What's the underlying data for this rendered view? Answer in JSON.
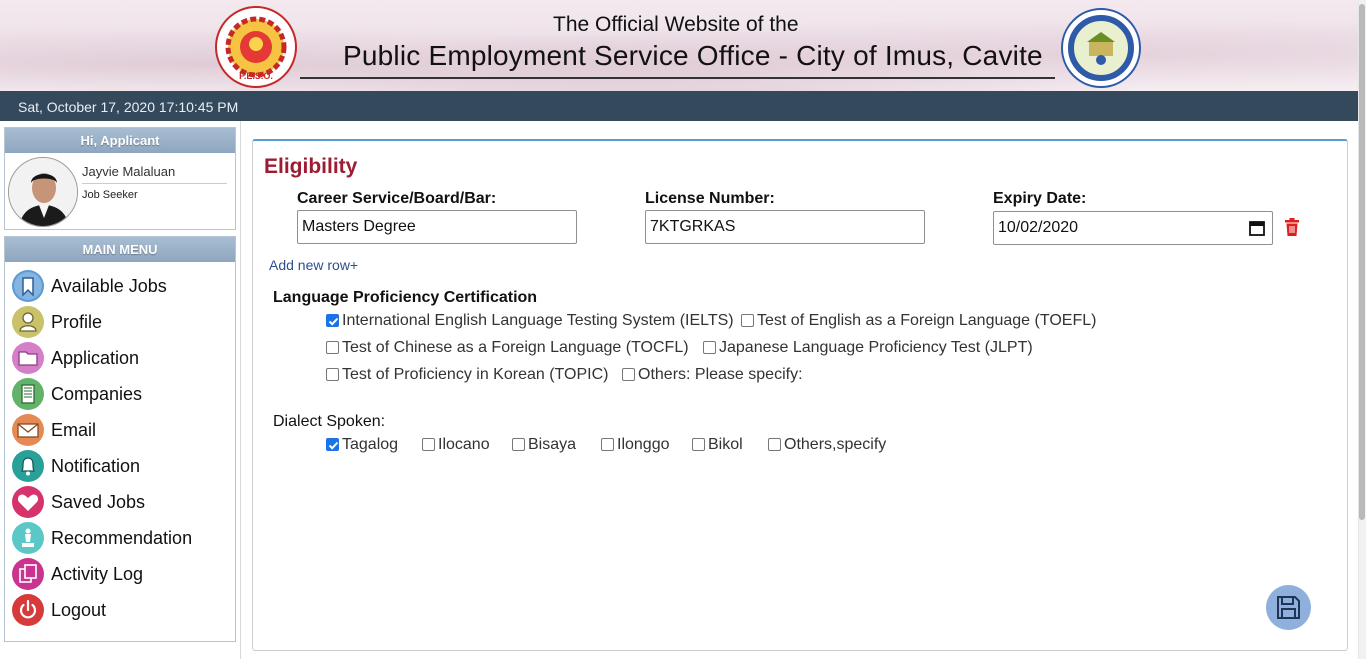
{
  "header": {
    "subtitle": "The Official Website of the",
    "title": "Public Employment Service Office - City of Imus, Cavite",
    "left_logo_name": "peso-logo",
    "right_logo_name": "imus-city-seal"
  },
  "datebar": {
    "datetime": "Sat, October 17, 2020 17:10:45 PM"
  },
  "user": {
    "greeting": "Hi, Applicant",
    "name": "Jayvie Malaluan",
    "role": "Job Seeker"
  },
  "menu": {
    "title": "MAIN MENU",
    "items": [
      {
        "label": "Available Jobs",
        "icon": "bookmark-icon",
        "color": "#5b9bd5"
      },
      {
        "label": "Profile",
        "icon": "user-icon",
        "color": "#c9c26a"
      },
      {
        "label": "Application",
        "icon": "folder-icon",
        "color": "#d47fc7"
      },
      {
        "label": "Companies",
        "icon": "building-icon",
        "color": "#63b26a"
      },
      {
        "label": "Email",
        "icon": "envelope-icon",
        "color": "#e58a55"
      },
      {
        "label": "Notification",
        "icon": "bell-icon",
        "color": "#2aa198"
      },
      {
        "label": "Saved Jobs",
        "icon": "heart-icon",
        "color": "#d6336c"
      },
      {
        "label": "Recommendation",
        "icon": "chess-icon",
        "color": "#5cc7c7"
      },
      {
        "label": "Activity Log",
        "icon": "copy-icon",
        "color": "#c9348f"
      },
      {
        "label": "Logout",
        "icon": "power-icon",
        "color": "#d63a3a"
      }
    ]
  },
  "eligibility": {
    "title": "Eligibility",
    "career_label": "Career Service/Board/Bar:",
    "career_value": "Masters Degree",
    "license_label": "License Number:",
    "license_value": "7KTGRKAS",
    "expiry_label": "Expiry Date:",
    "expiry_value": "10/02/2020",
    "add_row": "Add new row+"
  },
  "language": {
    "title": "Language Proficiency Certification",
    "options": [
      {
        "label": "International English Language Testing System (IELTS)",
        "checked": true
      },
      {
        "label": "Test of English as a Foreign Language (TOEFL)",
        "checked": false
      },
      {
        "label": "Test of Chinese as a Foreign Language (TOCFL)",
        "checked": false
      },
      {
        "label": "Japanese Language Proficiency Test (JLPT)",
        "checked": false
      },
      {
        "label": "Test of Proficiency in Korean (TOPIC)",
        "checked": false
      },
      {
        "label": "Others: Please specify:",
        "checked": false
      }
    ]
  },
  "dialect": {
    "title": "Dialect Spoken:",
    "options": [
      {
        "label": "Tagalog",
        "checked": true
      },
      {
        "label": "Ilocano",
        "checked": false
      },
      {
        "label": "Bisaya",
        "checked": false
      },
      {
        "label": "Ilonggo",
        "checked": false
      },
      {
        "label": "Bikol",
        "checked": false
      },
      {
        "label": "Others,specify",
        "checked": false
      }
    ]
  },
  "colors": {
    "datebar": "#35495c",
    "title_accent": "#9e1b32",
    "link": "#2b4f8f",
    "save_button": "#8fb0dc"
  }
}
